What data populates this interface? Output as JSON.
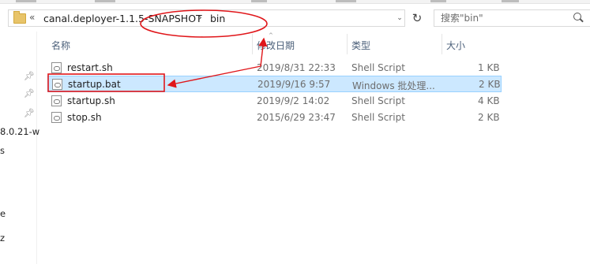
{
  "address_bar": {
    "overflow": "«",
    "segments": [
      "canal.deployer-1.1.5-SNAPSHOT",
      "bin"
    ],
    "separator": "›",
    "dropdown": "⌄",
    "refresh": "↻"
  },
  "search": {
    "placeholder": "搜索\"bin\""
  },
  "columns": {
    "name": "名称",
    "modified": "修改日期",
    "type": "类型",
    "size": "大小"
  },
  "nav": {
    "fragments": [
      "8.0.21-w",
      "s",
      "e",
      "z"
    ]
  },
  "files": [
    {
      "name": "restart.sh",
      "modified": "2019/8/31 22:33",
      "type": "Shell Script",
      "size": "1 KB",
      "selected": false
    },
    {
      "name": "startup.bat",
      "modified": "2019/9/16 9:57",
      "type": "Windows 批处理...",
      "size": "2 KB",
      "selected": true
    },
    {
      "name": "startup.sh",
      "modified": "2019/9/2 14:02",
      "type": "Shell Script",
      "size": "4 KB",
      "selected": false
    },
    {
      "name": "stop.sh",
      "modified": "2015/6/29 23:47",
      "type": "Shell Script",
      "size": "2 KB",
      "selected": false
    }
  ],
  "annotations": {
    "color": "#e0161a"
  },
  "colors": {
    "selection_bg": "#cce8ff",
    "selection_border": "#99d1ff",
    "header_text": "#4c607a"
  }
}
